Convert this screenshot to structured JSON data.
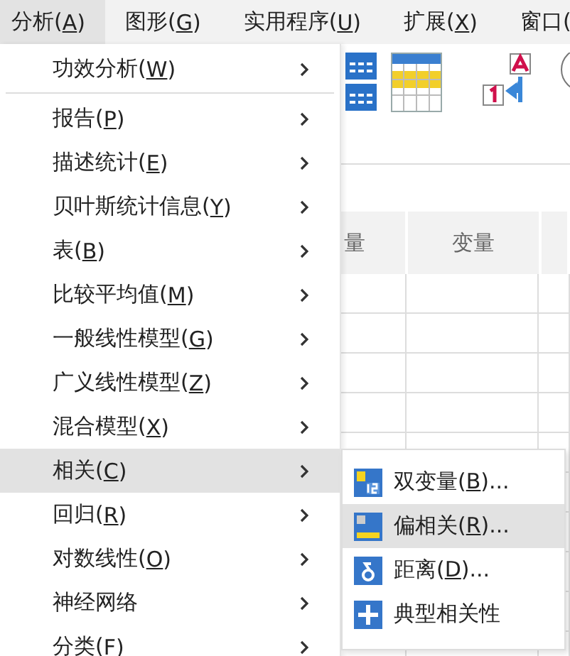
{
  "menubar": [
    {
      "before": "分析(",
      "key": "A",
      "after": ")",
      "selected": true
    },
    {
      "before": "图形(",
      "key": "G",
      "after": ")",
      "selected": false
    },
    {
      "before": "实用程序(",
      "key": "U",
      "after": ")",
      "selected": false
    },
    {
      "before": "扩展(",
      "key": "X",
      "after": ")",
      "selected": false
    },
    {
      "before": "窗口(",
      "selected": false
    }
  ],
  "grid": {
    "columns": [
      "量",
      "变量"
    ]
  },
  "menu": {
    "items": [
      {
        "kind": "item",
        "before": "功效分析(",
        "key": "W",
        "after": ")",
        "selected": false
      },
      {
        "kind": "separator"
      },
      {
        "kind": "item",
        "before": "报告(",
        "key": "P",
        "after": ")",
        "selected": false
      },
      {
        "kind": "item",
        "before": "描述统计(",
        "key": "E",
        "after": ")",
        "selected": false
      },
      {
        "kind": "item",
        "before": "贝叶斯统计信息(",
        "key": "Y",
        "after": ")",
        "selected": false
      },
      {
        "kind": "item",
        "before": "表(",
        "key": "B",
        "after": ")",
        "selected": false
      },
      {
        "kind": "item",
        "before": "比较平均值(",
        "key": "M",
        "after": ")",
        "selected": false
      },
      {
        "kind": "item",
        "before": "一般线性模型(",
        "key": "G",
        "after": ")",
        "selected": false
      },
      {
        "kind": "item",
        "before": "广义线性模型(",
        "key": "Z",
        "after": ")",
        "selected": false
      },
      {
        "kind": "item",
        "before": "混合模型(",
        "key": "X",
        "after": ")",
        "selected": false
      },
      {
        "kind": "item",
        "before": "相关(",
        "key": "C",
        "after": ")",
        "selected": true
      },
      {
        "kind": "item",
        "before": "回归(",
        "key": "R",
        "after": ")",
        "selected": false
      },
      {
        "kind": "item",
        "before": "对数线性(",
        "key": "O",
        "after": ")",
        "selected": false
      },
      {
        "kind": "item",
        "before": "神经网络",
        "selected": false
      },
      {
        "kind": "item",
        "before": "分类(",
        "key": "F",
        "after": ")",
        "selected": false
      }
    ]
  },
  "submenu": {
    "items": [
      {
        "kind": "bivariate",
        "before": "双变量(",
        "key": "B",
        "after": ")...",
        "selected": false
      },
      {
        "kind": "partial",
        "before": "偏相关(",
        "key": "R",
        "after": ")...",
        "selected": true
      },
      {
        "kind": "distance",
        "before": "距离(",
        "key": "D",
        "after": ")...",
        "selected": false
      },
      {
        "kind": "canonical",
        "before": "典型相关性",
        "selected": false
      }
    ]
  }
}
